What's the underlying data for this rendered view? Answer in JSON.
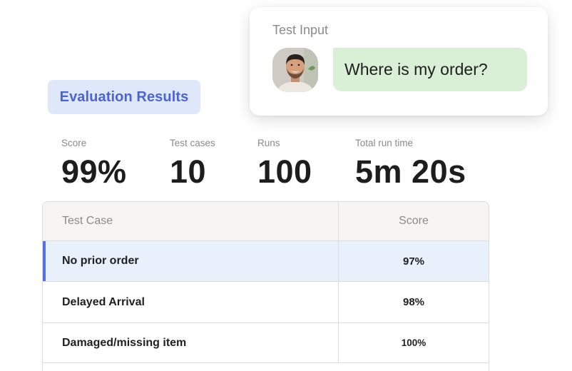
{
  "test_input": {
    "title": "Test Input",
    "message": "Where is my order?",
    "avatar_icon": "person-avatar-icon",
    "bubble_color": "#d9f0d6"
  },
  "evaluation": {
    "title": "Evaluation Results",
    "accent_color": "#4a64d8"
  },
  "stats": {
    "score_label": "Score",
    "score_value": "99%",
    "cases_label": "Test cases",
    "cases_value": "10",
    "runs_label": "Runs",
    "runs_value": "100",
    "time_label": "Total run time",
    "time_value": "5m 20s"
  },
  "table": {
    "headers": [
      "Test Case",
      "Score"
    ],
    "rows": [
      {
        "name": "No prior order",
        "score": "97%",
        "selected": true
      },
      {
        "name": "Delayed Arrival",
        "score": "98%"
      },
      {
        "name": "Damaged/missing item",
        "score": "100%"
      }
    ]
  }
}
